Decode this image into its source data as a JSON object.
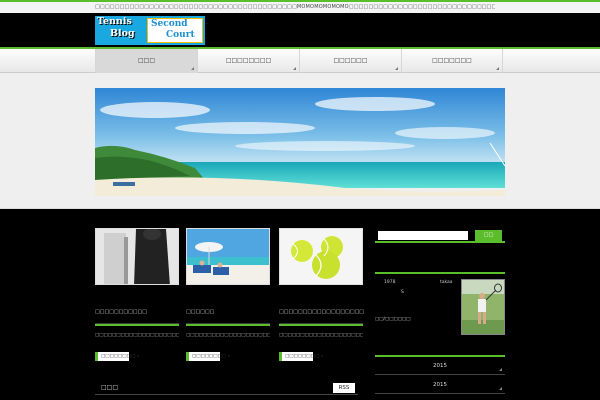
{
  "topbar": {
    "description": "□□□□□□□□□□□□□□□□□□□□□□□□□□□□□□□□□□□□□□□□□MOMOMOMOMOMO□□□□□□□□□□□□□□□□□□□□□□□□□□□□□□□□□□□□□□□□□□□□□□□□□□□□□□□□□□□□□□□□□□□□□□□□□□□□□□□□□□□□□□□□□□□□"
  },
  "logo": {
    "line1": "Tennis",
    "line2": "Blog",
    "line3": "Second",
    "line4": "Court"
  },
  "nav": {
    "items": [
      {
        "label": "□□□"
      },
      {
        "label": "□□□□□□□□"
      },
      {
        "label": "□□□□□□"
      },
      {
        "label": "□□□□□□□"
      }
    ]
  },
  "cards": [
    {
      "title": "□□□□□□□□□□□",
      "text": "□□□□□□□□□□□□□□□□□□□□□□□□□□□□□□□□□□□□□□□□□□□□□□□□□□□□□□□□□□□□□□□□□□",
      "button": "□□□□□□□□ »"
    },
    {
      "title": "□□□□□□",
      "text": "□□□□□□□□□□□□□□□□□□□□□□□□□□□□□□□□□□□□□□□□□□□□□□□□□□□",
      "button": "□□□□□□□□ »"
    },
    {
      "title": "□□□□□□□□□□□□□□□□□□",
      "text": "□□□□□□□□□□□□□□□□□□□□□□□□□□□□□□□□□□□□□□□□□□□□□□□□□□□□□□□□□□□□□□□□□□□□□□□□□",
      "button": "□□□□□□□□ »"
    }
  ],
  "news": {
    "title": "□□□",
    "rss": "RSS"
  },
  "search": {
    "placeholder": "",
    "button": "□□"
  },
  "profile": {
    "num": "1978",
    "name": "takaa",
    "mark": "S",
    "sub": "□□/□□□□□□"
  },
  "archive": {
    "items": [
      {
        "label": "2015"
      },
      {
        "label": "2015"
      }
    ]
  },
  "colors": {
    "accent": "#5bbd2b",
    "logo_blue": "#19a9e0"
  }
}
